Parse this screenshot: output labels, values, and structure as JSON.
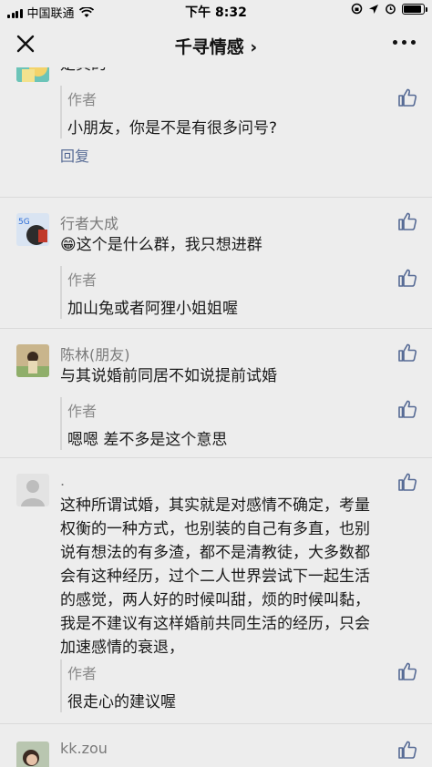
{
  "status": {
    "carrier": "中国联通",
    "time": "下午 8:32",
    "battery_level": 0.9
  },
  "nav": {
    "title": "千寻情感 ›"
  },
  "comments": [
    {
      "text": "是真的",
      "reply": {
        "author": "作者",
        "text": "小朋友，你是不是有很多问号?"
      },
      "reply_link": "回复"
    },
    {
      "name": "行者大成",
      "text": "这个是什么群，我只想进群",
      "emoji": "😁",
      "reply": {
        "author": "作者",
        "text": "加山兔或者阿狸小姐姐喔"
      }
    },
    {
      "name": "陈林(朋友)",
      "text": "与其说婚前同居不如说提前试婚",
      "reply": {
        "author": "作者",
        "text": "嗯嗯 差不多是这个意思"
      }
    },
    {
      "name": ".",
      "lines": [
        "这种所谓试婚，其实就是对感情不确定，考量",
        "权衡的一种方式，也别装的自己有多直，也别",
        "说有想法的有多渣，都不是清教徒，大多数都",
        "会有这种经历，过个二人世界尝试下一起生活",
        "的感觉，两人好的时候叫甜，烦的时候叫黏，",
        "我是不建议有这样婚前共同生活的经历，只会",
        "加速感情的衰退，"
      ],
      "reply": {
        "author": "作者",
        "text": "很走心的建议喔"
      }
    },
    {
      "name": "kk.zou"
    }
  ]
}
